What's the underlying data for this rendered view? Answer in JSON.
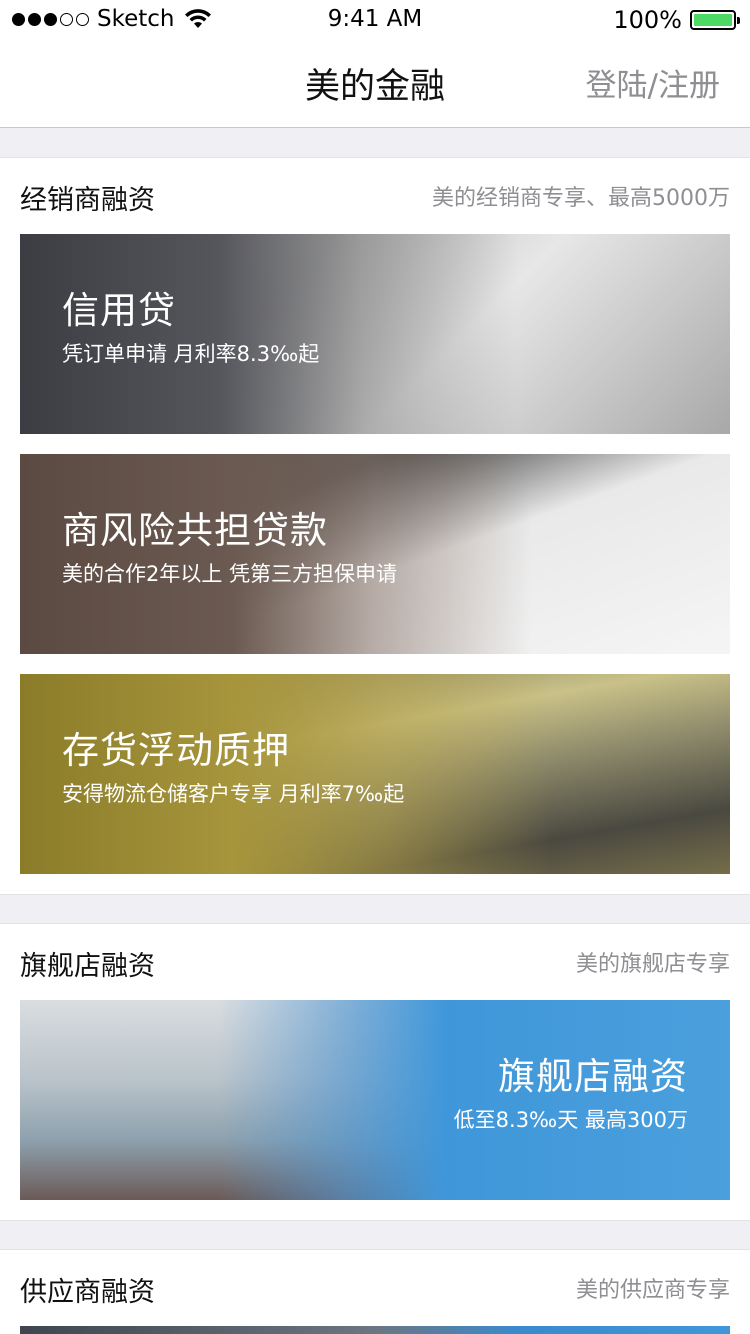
{
  "status_bar": {
    "carrier": "Sketch",
    "time": "9:41 AM",
    "battery": "100%",
    "signal_dots": 5,
    "signal_filled": 3,
    "battery_level": 1.0,
    "icons": [
      "wifi-icon",
      "battery-icon",
      "signal-icon"
    ]
  },
  "nav": {
    "title": "美的金融",
    "login": "登陆/注册"
  },
  "sections": {
    "dealer": {
      "title": "经销商融资",
      "subtitle": "美的经销商专享、最高5000万",
      "banners": [
        {
          "title": "信用贷",
          "subtitle": "凭订单申请  月利率8.3‰起"
        },
        {
          "title": "商风险共担贷款",
          "subtitle": "美的合作2年以上 凭第三方担保申请"
        },
        {
          "title": "存货浮动质押",
          "subtitle": "安得物流仓储客户专享  月利率7‰起"
        }
      ]
    },
    "store": {
      "title": "旗舰店融资",
      "subtitle": "美的旗舰店专享",
      "banner": {
        "title": "旗舰店融资",
        "subtitle": "低至8.3‰天   最高300万"
      }
    },
    "supplier": {
      "title": "供应商融资",
      "subtitle": "美的供应商专享"
    }
  },
  "colors": {
    "background": "#efeff4",
    "battery_green": "#4cd964",
    "secondary_text": "#8e8e93",
    "store_blue": "#3f97da"
  }
}
